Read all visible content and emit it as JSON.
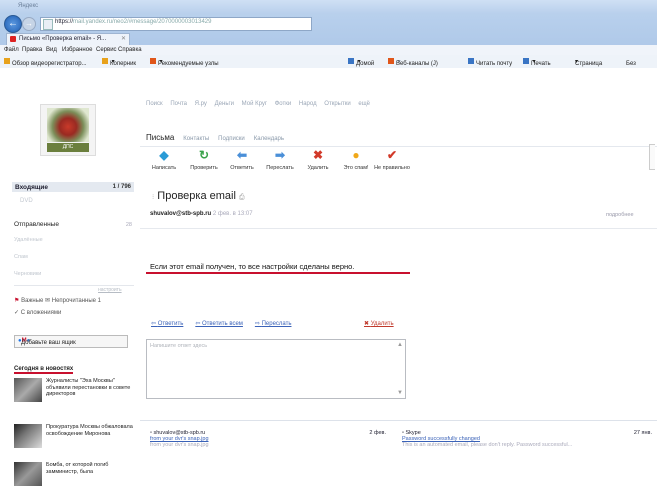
{
  "browser": {
    "window_title": "Яндекс",
    "url_prefix": "https://",
    "url_host": "mail.yandex.ru",
    "url_rest": "/neo2/#message/2070000003013429",
    "tab_title": "Письмо «Проверка email» - Я...",
    "menu": [
      "Файл",
      "Правка",
      "Вид",
      "Избранное",
      "Сервис",
      "Справка"
    ],
    "favorites": [
      "Обзор видеорегистратор...",
      "Коперник",
      "Рекомендуемые узлы"
    ],
    "toolbar_right": [
      "Домой",
      "Веб-каналы (J)",
      "Читать почту",
      "Печать",
      "Страница",
      "Без"
    ]
  },
  "mail": {
    "top_nav": [
      "Поиск",
      "Почта",
      "Я.ру",
      "Деньги",
      "Мой Круг",
      "Фотки",
      "Народ",
      "Открытки",
      "ещё"
    ],
    "tabs": [
      "Письма",
      "Контакты",
      "Подписки",
      "Календарь"
    ],
    "toolbar": [
      {
        "label": "Написать",
        "icon": "compose-icon",
        "glyph": "◆",
        "color": "#2a9bd6"
      },
      {
        "label": "Проверить",
        "icon": "refresh-icon",
        "glyph": "↻",
        "color": "#3aa24a"
      },
      {
        "label": "Ответить",
        "icon": "reply-icon",
        "glyph": "⬅",
        "color": "#4a8fd8"
      },
      {
        "label": "Переслать",
        "icon": "forward-icon",
        "glyph": "➡",
        "color": "#4a8fd8"
      },
      {
        "label": "Удалить",
        "icon": "delete-icon",
        "glyph": "✖",
        "color": "#d23a2a"
      },
      {
        "label": "Это спам!",
        "icon": "spam-icon",
        "glyph": "●",
        "color": "#f0a81a"
      },
      {
        "label": "Не правильно",
        "icon": "not-spam-icon",
        "glyph": "✔",
        "color": "#d23a2a"
      }
    ],
    "logo_caption": "ДПС",
    "folders": {
      "inbox": {
        "label": "Входящие",
        "count": "1 / 796"
      },
      "sent": {
        "label": "Отправленные",
        "count": "28"
      },
      "items": [
        "Удалённые",
        "Спам",
        "Черновики"
      ],
      "create_link": "настроить",
      "important": "Важные",
      "unread": "Непрочитанные",
      "unread_count": "1",
      "attachments": "С вложениями"
    },
    "add_mail": "Добавьте ваш ящик",
    "news_title": "Сегодня в новостях",
    "news": [
      "Журналисты \"Эха Москвы\" объявили перестановки в совете директоров",
      "Прокуратура Москвы обжаловала освобождение Миронова",
      "Бомба, от которой погиб замминистр, была"
    ],
    "message": {
      "subject": "Проверка email",
      "sender": "shuvalov@stb-spb.ru",
      "date": "2 фев. в 13:07",
      "details_link": "подробнее",
      "body": "Если этот email получен, то все настройки сделаны верно.",
      "actions": [
        "Ответить",
        "Ответить всем",
        "Переслать"
      ],
      "delete_action": "Удалить",
      "reply_placeholder": "Напишите ответ здесь"
    },
    "bottom_messages": [
      {
        "from": "shuvalov@stb-spb.ru",
        "subject": "from your dvr's snap.jpg",
        "preview": "from your dvr's snap.jpg",
        "date": "2 фев."
      },
      {
        "from": "Skype",
        "subject": "Password successfully changed",
        "preview": "This is an automated email, please don't reply. Password successful...",
        "date": "27 янв."
      }
    ]
  }
}
